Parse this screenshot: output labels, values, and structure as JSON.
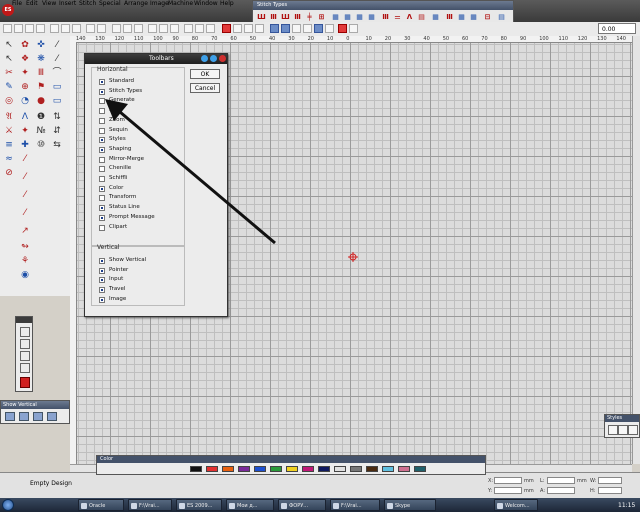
{
  "app": {
    "logo": "ES"
  },
  "menu": [
    "File",
    "Edit",
    "View",
    "Insert",
    "Stitch",
    "Special",
    "Arrange",
    "Image",
    "Machine",
    "Window",
    "Help"
  ],
  "stitch_types_toolbar": {
    "title": "Stitch Types"
  },
  "zoom": {
    "value": "0.00"
  },
  "ruler": {
    "top_labels": [
      "140",
      "130",
      "120",
      "110",
      "100",
      "90",
      "80",
      "70",
      "60",
      "50",
      "40",
      "30",
      "20",
      "10",
      "0",
      "10",
      "20",
      "30",
      "40",
      "50",
      "60",
      "70",
      "80",
      "90",
      "100",
      "110",
      "120",
      "130",
      "140"
    ]
  },
  "toolbars_dialog": {
    "title": "Toolbars",
    "ok_label": "OK",
    "cancel_label": "Cancel",
    "horizontal_label": "Horizontal",
    "vertical_label": "Vertical",
    "horizontal_items": [
      {
        "label": "Standard",
        "checked": true
      },
      {
        "label": "Stitch Types",
        "checked": true
      },
      {
        "label": "Generate",
        "checked": false
      },
      {
        "label": "Edit",
        "checked": false
      },
      {
        "label": "Zoom",
        "checked": false
      },
      {
        "label": "Sequin",
        "checked": false
      },
      {
        "label": "Styles",
        "checked": true
      },
      {
        "label": "Shaping",
        "checked": true
      },
      {
        "label": "Mirror-Merge",
        "checked": false
      },
      {
        "label": "Chenille",
        "checked": false
      },
      {
        "label": "Schiffli",
        "checked": false
      },
      {
        "label": "Color",
        "checked": true
      },
      {
        "label": "Transform",
        "checked": false
      },
      {
        "label": "Status Line",
        "checked": true
      },
      {
        "label": "Prompt Message",
        "checked": true
      },
      {
        "label": "Clipart",
        "checked": false
      }
    ],
    "vertical_items": [
      {
        "label": "Show Vertical",
        "checked": true
      },
      {
        "label": "Pointer",
        "checked": true
      },
      {
        "label": "Input",
        "checked": true
      },
      {
        "label": "Travel",
        "checked": true
      },
      {
        "label": "Image",
        "checked": true
      }
    ]
  },
  "show_vertical_palette": {
    "title": "Show Vertical"
  },
  "right_palette": {
    "title": "Styles"
  },
  "color_bar": {
    "title": "Color",
    "swatches": [
      "#111111",
      "#e23030",
      "#e86010",
      "#7a2a9a",
      "#1c4fd0",
      "#2a9a3a",
      "#f0d020",
      "#c01878",
      "#101a60",
      "#e0e0e0",
      "#777777",
      "#4a2a10",
      "#60c0e0",
      "#d07090",
      "#20606a"
    ]
  },
  "status": {
    "text": "Empty Design",
    "x_label": "X:",
    "y_label": "Y:",
    "l_label": "L:",
    "a_label": "A:",
    "w_label": "W:",
    "h_label": "H:",
    "unit": "mm"
  },
  "taskbar": {
    "tasks": [
      "Oracle",
      "F:\\Vrai...",
      "ES 2009...",
      "Мои д...",
      "ФОРУ...",
      "F:\\Vrai...",
      "Skype",
      "Welcom..."
    ],
    "clock": "11:15"
  }
}
